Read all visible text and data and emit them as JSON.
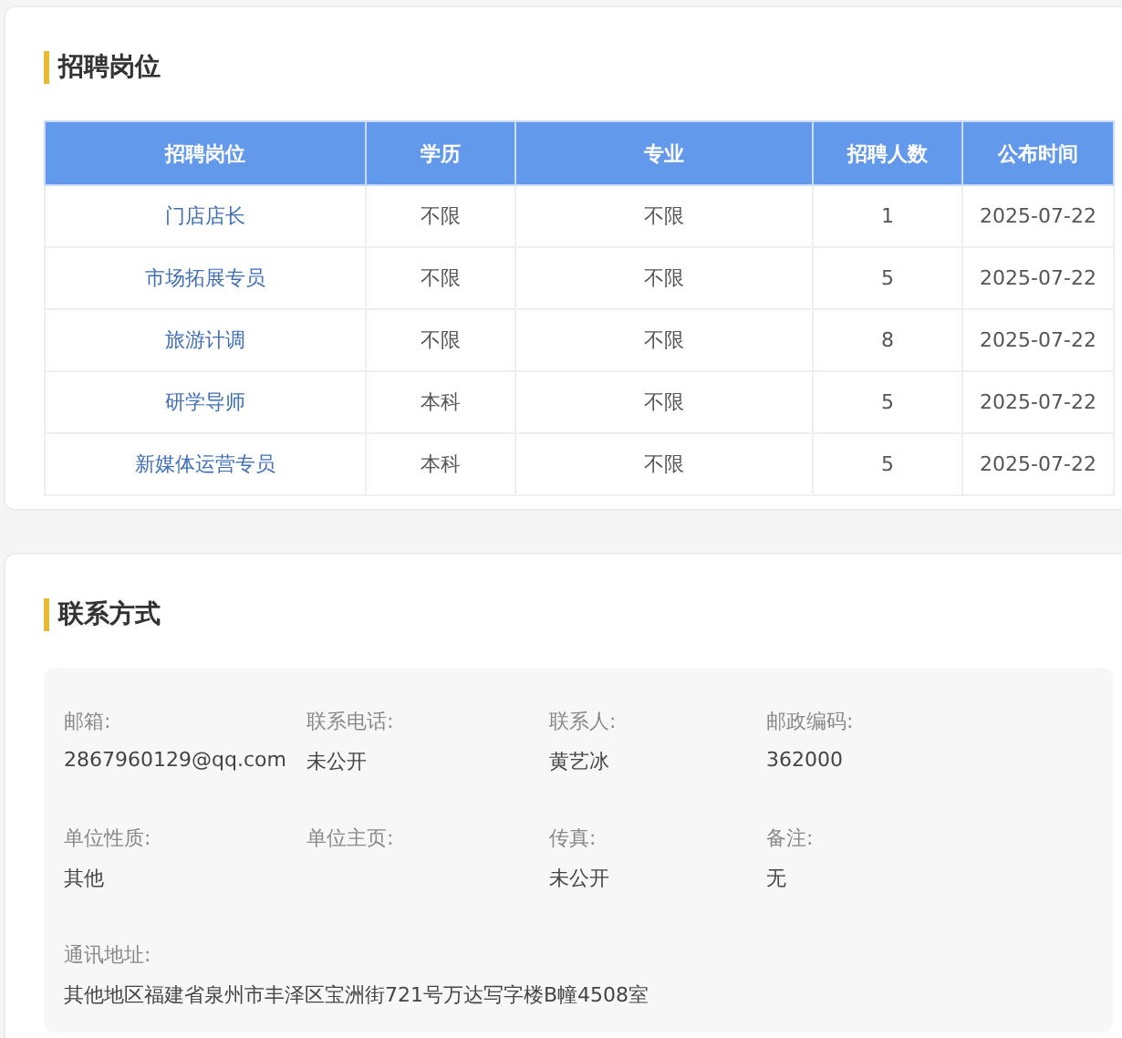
{
  "jobs_section": {
    "title": "招聘岗位",
    "table": {
      "columns": [
        "招聘岗位",
        "学历",
        "专业",
        "招聘人数",
        "公布时间"
      ],
      "rows": [
        {
          "position": "门店店长",
          "education": "不限",
          "major": "不限",
          "count": "1",
          "date": "2025-07-22"
        },
        {
          "position": "市场拓展专员",
          "education": "不限",
          "major": "不限",
          "count": "5",
          "date": "2025-07-22"
        },
        {
          "position": "旅游计调",
          "education": "不限",
          "major": "不限",
          "count": "8",
          "date": "2025-07-22"
        },
        {
          "position": "研学导师",
          "education": "本科",
          "major": "不限",
          "count": "5",
          "date": "2025-07-22"
        },
        {
          "position": "新媒体运营专员",
          "education": "本科",
          "major": "不限",
          "count": "5",
          "date": "2025-07-22"
        }
      ]
    }
  },
  "contact_section": {
    "title": "联系方式",
    "fields": [
      {
        "label": "邮箱:",
        "value": "2867960129@qq.com"
      },
      {
        "label": "联系电话:",
        "value": "未公开"
      },
      {
        "label": "联系人:",
        "value": "黄艺冰"
      },
      {
        "label": "邮政编码:",
        "value": "362000"
      },
      {
        "label": "单位性质:",
        "value": "其他"
      },
      {
        "label": "单位主页:"
      },
      {
        "label": "传真:",
        "value": "未公开"
      },
      {
        "label": "备注:",
        "value": "无"
      }
    ],
    "address": {
      "label": "通讯地址:",
      "value": "其他地区福建省泉州市丰泽区宝洲街721号万达写字楼B幢4508室"
    }
  }
}
